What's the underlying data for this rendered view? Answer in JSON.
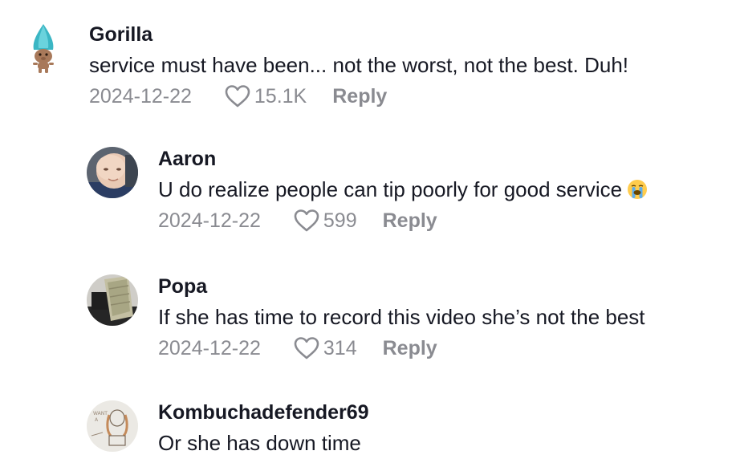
{
  "comments": [
    {
      "username": "Gorilla",
      "text": "service must have been... not the worst, not the best. Duh!",
      "date": "2024-12-22",
      "likes": "15.1K",
      "reply_label": "Reply",
      "avatar": "troll-doll-avatar"
    },
    {
      "username": "Aaron",
      "text": "U do realize people can tip poorly for good service",
      "emoji": "loudly-crying-face-emoji",
      "date": "2024-12-22",
      "likes": "599",
      "reply_label": "Reply",
      "avatar": "baby-photo-avatar"
    },
    {
      "username": "Popa",
      "text": "If she has time to record this video she’s not the best",
      "date": "2024-12-22",
      "likes": "314",
      "reply_label": "Reply",
      "avatar": "cash-stack-avatar"
    },
    {
      "username": "Kombuchadefender69",
      "text": "Or she has down time",
      "avatar": "sketch-drawing-avatar"
    }
  ],
  "colors": {
    "primary_text": "#161823",
    "secondary_text": "#8a8b91"
  }
}
